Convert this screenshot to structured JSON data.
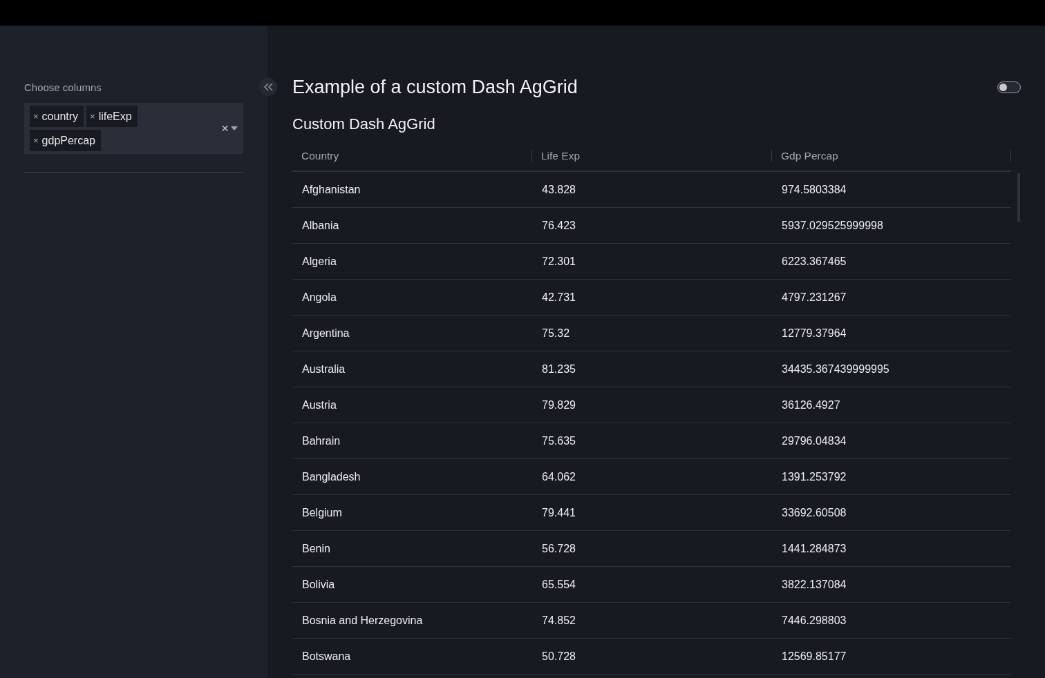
{
  "sidebar": {
    "label": "Choose columns",
    "selected_columns": [
      {
        "remove_icon": "×",
        "label": "country"
      },
      {
        "remove_icon": "×",
        "label": "lifeExp"
      },
      {
        "remove_icon": "×",
        "label": "gdpPercap"
      }
    ],
    "clear_icon": "×"
  },
  "page": {
    "title": "Example of a custom Dash AgGrid",
    "theme_toggle": {
      "on": false
    },
    "subtitle": "Custom Dash AgGrid"
  },
  "table": {
    "columns": [
      "Country",
      "Life Exp",
      "Gdp Percap"
    ],
    "rows": [
      [
        "Afghanistan",
        "43.828",
        "974.5803384"
      ],
      [
        "Albania",
        "76.423",
        "5937.029525999998"
      ],
      [
        "Algeria",
        "72.301",
        "6223.367465"
      ],
      [
        "Angola",
        "42.731",
        "4797.231267"
      ],
      [
        "Argentina",
        "75.32",
        "12779.37964"
      ],
      [
        "Australia",
        "81.235",
        "34435.367439999995"
      ],
      [
        "Austria",
        "79.829",
        "36126.4927"
      ],
      [
        "Bahrain",
        "75.635",
        "29796.04834"
      ],
      [
        "Bangladesh",
        "64.062",
        "1391.253792"
      ],
      [
        "Belgium",
        "79.441",
        "33692.60508"
      ],
      [
        "Benin",
        "56.728",
        "1441.284873"
      ],
      [
        "Bolivia",
        "65.554",
        "3822.137084"
      ],
      [
        "Bosnia and Herzegovina",
        "74.852",
        "7446.298803"
      ],
      [
        "Botswana",
        "50.728",
        "12569.85177"
      ]
    ]
  }
}
